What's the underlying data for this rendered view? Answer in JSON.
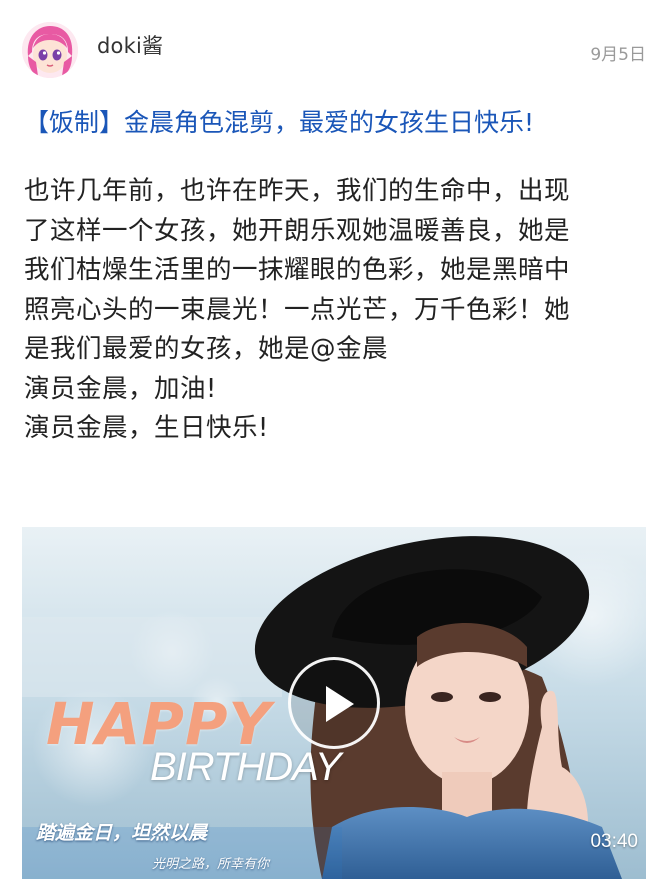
{
  "post": {
    "author": {
      "name": "doki酱",
      "avatar_icon": "anime-girl-avatar"
    },
    "date": "9月5日",
    "title": "【饭制】金晨角色混剪，最爱的女孩生日快乐!",
    "body_lines": [
      "也许几年前，也许在昨天，我们的生命中，出现",
      "了这样一个女孩，她开朗乐观她温暖善良，她是",
      "我们枯燥生活里的一抹耀眼的色彩，她是黑暗中",
      "照亮心头的一束晨光！一点光芒，万千色彩！她",
      "是我们最爱的女孩，她是@金晨",
      "演员金晨，加油!",
      "演员金晨，生日快乐!"
    ],
    "video": {
      "overlay_happy": "HAPPY",
      "overlay_birthday": "BIRTHDAY",
      "overlay_caption": "踏遍金日，坦然以晨",
      "overlay_subcaption": "光明之路，所幸有你",
      "duration": "03:40",
      "play_icon": "play-icon"
    }
  },
  "colors": {
    "title_link": "#1a56b8",
    "body_text": "#222222",
    "date_text": "#9a9a9a",
    "happy_text": "#f4a07e"
  }
}
